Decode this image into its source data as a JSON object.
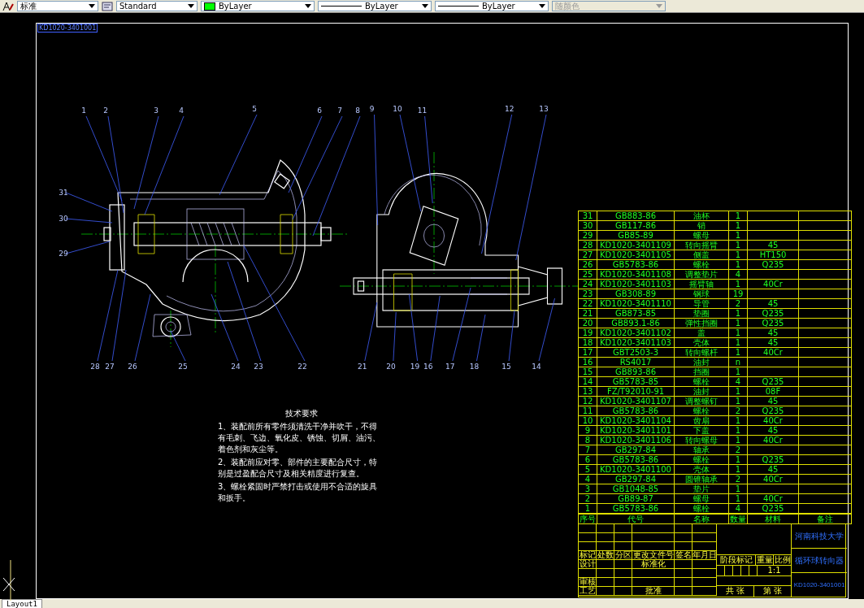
{
  "toolbar": {
    "dropdowns": [
      {
        "kind": "text",
        "value": "标准",
        "disabled": false
      },
      {
        "kind": "text",
        "value": "Standard",
        "disabled": false
      },
      {
        "kind": "color",
        "value": "ByLayer",
        "color": "#00ff00",
        "disabled": false
      },
      {
        "kind": "linetype",
        "value": "ByLayer",
        "disabled": false
      },
      {
        "kind": "linetype",
        "value": "ByLayer",
        "disabled": false
      },
      {
        "kind": "text",
        "value": "随颜色",
        "disabled": true
      }
    ]
  },
  "drawing_label": "KD1020-3401001",
  "callouts": [
    "1",
    "2",
    "3",
    "4",
    "5",
    "6",
    "7",
    "8",
    "9",
    "10",
    "11",
    "12",
    "13",
    "31",
    "30",
    "29",
    "28",
    "27",
    "26",
    "25",
    "24",
    "23",
    "22",
    "21",
    "20",
    "19",
    "16",
    "17",
    "18",
    "15",
    "14"
  ],
  "technical_requirements": {
    "title": "技术要求",
    "items": [
      "1、装配前所有零件须清洗干净并吹干，不得有毛刺、飞边、氧化皮、锈蚀、切屑、油污、着色剂和灰尘等。",
      "2、装配前应对零、部件的主要配合尺寸，特别是过盈配合尺寸及相关精度进行复查。",
      "3、螺栓紧固时严禁打击或使用不合适的旋具和扳手。"
    ]
  },
  "parts_list": {
    "rows": [
      [
        "31",
        "GB883-86",
        "油杯",
        "1",
        null
      ],
      [
        "30",
        "GB117-86",
        "销",
        "1",
        null
      ],
      [
        "29",
        "GB85-89",
        "螺母",
        "1",
        null
      ],
      [
        "28",
        "KD1020-3401109",
        "转向摇臂",
        "1",
        "45"
      ],
      [
        "27",
        "KD1020-3401105",
        "侧盖",
        "1",
        "HT150"
      ],
      [
        "26",
        "GB5783-86",
        "螺栓",
        "1",
        "Q235"
      ],
      [
        "25",
        "KD1020-3401108",
        "调整垫片",
        "4",
        null
      ],
      [
        "24",
        "KD1020-3401103",
        "摇臂轴",
        "1",
        "40Cr"
      ],
      [
        "23",
        "GB308-89",
        "钢球",
        "19",
        null
      ],
      [
        "22",
        "KD1020-3401110",
        "导管",
        "2",
        "45"
      ],
      [
        "21",
        "GB873-85",
        "垫圈",
        "1",
        "Q235"
      ],
      [
        "20",
        "GB893.1-86",
        "弹性挡圈",
        "1",
        "Q235"
      ],
      [
        "19",
        "KD1020-3401102",
        "盖",
        "1",
        "45"
      ],
      [
        "18",
        "KD1020-3401103",
        "壳体",
        "1",
        "45"
      ],
      [
        "17",
        "GBT2503-3",
        "转向螺杆",
        "1",
        "40Cr"
      ],
      [
        "16",
        "RS4017",
        "油封",
        "n",
        null
      ],
      [
        "15",
        "GB893-86",
        "挡圈",
        "1",
        null
      ],
      [
        "14",
        "GB5783-85",
        "螺栓",
        "4",
        "Q235"
      ],
      [
        "13",
        "FZ/T92010-91",
        "油封",
        "1",
        "08F"
      ],
      [
        "12",
        "KD1020-3401107",
        "调整螺钉",
        "1",
        "45"
      ],
      [
        "11",
        "GB5783-86",
        "螺栓",
        "2",
        "Q235"
      ],
      [
        "10",
        "KD1020-3401104",
        "齿扇",
        "1",
        "40Cr"
      ],
      [
        "9",
        "KD1020-3401101",
        "下盖",
        "1",
        "45"
      ],
      [
        "8",
        "KD1020-3401106",
        "转向螺母",
        "1",
        "40Cr"
      ],
      [
        "7",
        "GB297-84",
        "轴承",
        "2",
        null
      ],
      [
        "6",
        "GB5783-86",
        "螺栓",
        "1",
        "Q235"
      ],
      [
        "5",
        "KD1020-3401100",
        "壳体",
        "1",
        "45"
      ],
      [
        "4",
        "GB297-84",
        "圆锥轴承",
        "2",
        "40Cr"
      ],
      [
        "3",
        "GB1048-85",
        "垫片",
        "1",
        null
      ],
      [
        "2",
        "GB89-87",
        "螺母",
        "1",
        "40Cr"
      ],
      [
        "1",
        "GB5783-86",
        "螺栓",
        "4",
        "Q235"
      ]
    ],
    "label_row": [
      "序号",
      "代号",
      "名称",
      "数量",
      "材料",
      "备注"
    ]
  },
  "title_block": {
    "revision_labels": [
      "标记",
      "处数",
      "分区",
      "更改文件号",
      "签名",
      "年月日"
    ],
    "approval_labels": [
      "设计",
      "标准化",
      "审核",
      "工艺",
      "批准"
    ],
    "stage_label": "阶段标记",
    "weight_label": "重量",
    "scale_label": "比例",
    "scale": "1:1",
    "sheet_total": "共 张",
    "sheet_number": "第 张",
    "school": "河南科技大学",
    "drawing_title": "循环球转向器",
    "drawing_number": "KD1020-3401001"
  },
  "layout_tab": "Layout1"
}
